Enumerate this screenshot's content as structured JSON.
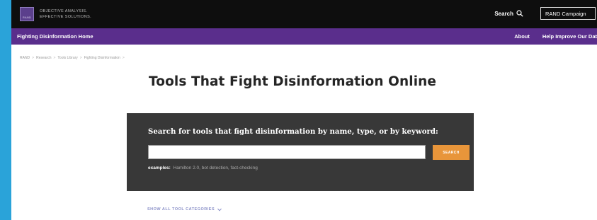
{
  "header": {
    "logo_text": "RAND",
    "tagline_1": "OBJECTIVE ANALYSIS.",
    "tagline_2": "EFFECTIVE SOLUTIONS.",
    "search_label": "Search",
    "campaign_label": "RAND Campaign"
  },
  "nav": {
    "site_title": "Fighting Disinformation Home",
    "about": "About",
    "help": "Help Improve Our Dat"
  },
  "breadcrumb": {
    "items": [
      "RAND",
      "Research",
      "Tools Library",
      "Fighting Disinformation"
    ],
    "sep": ">"
  },
  "page": {
    "title": "Tools That Fight Disinformation Online"
  },
  "search": {
    "heading": "Search for tools that fight disinformation by name, type, or by keyword:",
    "value": "",
    "button": "SEARCH",
    "examples_label": "examples:",
    "examples": "Hamilton 2.0, bot detection, fact-checking"
  },
  "show_all": {
    "label": "SHOW ALL TOOL CATEGORIES"
  },
  "colors": {
    "top_bar": "#0e0e0e",
    "nav_bar": "#5a2e8c",
    "panel": "#383838",
    "button": "#e8953a",
    "link": "#8a90c8",
    "backdrop": "#2aa3d9"
  }
}
